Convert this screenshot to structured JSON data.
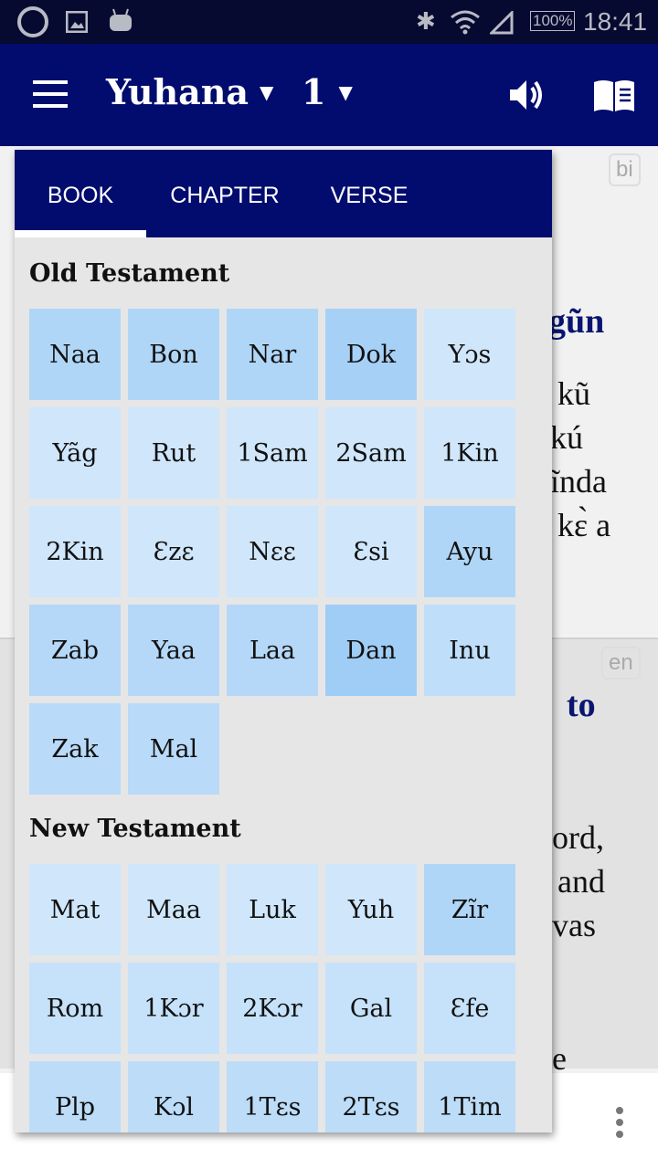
{
  "status_bar": {
    "time": "18:41",
    "battery": "100%",
    "icons": [
      "app-logo-icon",
      "image-icon",
      "android-icon",
      "bluetooth-icon",
      "wifi-icon",
      "signal-icon",
      "battery-icon"
    ]
  },
  "app_bar": {
    "book": "Yuhana",
    "chapter": "1",
    "icons": [
      "menu-icon",
      "speaker-icon",
      "book-icon"
    ]
  },
  "background": {
    "badge_top": "bi",
    "heading_top": "gũn",
    "lines_top": [
      "kũ",
      "kú",
      "ĩnda",
      "kɛ̀ a"
    ],
    "badge_bottom": "en",
    "heading_bottom": "to",
    "lines_bottom": [
      "ord,",
      "and",
      "vas",
      "e"
    ],
    "more_icon": "more-vert-icon"
  },
  "popup": {
    "tabs": [
      {
        "label": "BOOK",
        "active": true
      },
      {
        "label": "CHAPTER"
      },
      {
        "label": "VERSE"
      }
    ],
    "old_testament": {
      "title": "Old Testament",
      "books": [
        {
          "label": "Naa",
          "color": "#b0d6f7"
        },
        {
          "label": "Bon",
          "color": "#b0d6f7"
        },
        {
          "label": "Nar",
          "color": "#b0d6f7"
        },
        {
          "label": "Dok",
          "color": "#a7d0f6"
        },
        {
          "label": "Yɔs",
          "color": "#cfe6fb"
        },
        {
          "label": "Yãg",
          "color": "#cfe6fb"
        },
        {
          "label": "Rut",
          "color": "#cfe6fb"
        },
        {
          "label": "1Sam",
          "color": "#cfe6fb"
        },
        {
          "label": "2Sam",
          "color": "#cfe6fb"
        },
        {
          "label": "1Kin",
          "color": "#cfe6fb"
        },
        {
          "label": "2Kin",
          "color": "#cfe6fb"
        },
        {
          "label": "Ɛzɛ",
          "color": "#cfe6fb"
        },
        {
          "label": "Nɛɛ",
          "color": "#cfe6fb"
        },
        {
          "label": "Ɛsi",
          "color": "#cfe6fb"
        },
        {
          "label": "Ayu",
          "color": "#b0d6f7"
        },
        {
          "label": "Zab",
          "color": "#b5d8f8"
        },
        {
          "label": "Yaa",
          "color": "#b5d8f8"
        },
        {
          "label": "Laa",
          "color": "#b5d8f8"
        },
        {
          "label": "Dan",
          "color": "#9fcdf5"
        },
        {
          "label": "Inu",
          "color": "#bfdefa"
        },
        {
          "label": "Zak",
          "color": "#b9daf8"
        },
        {
          "label": "Mal",
          "color": "#b9daf8"
        }
      ]
    },
    "new_testament": {
      "title": "New Testament",
      "books": [
        {
          "label": "Mat",
          "color": "#cfe6fb"
        },
        {
          "label": "Maa",
          "color": "#cfe6fb"
        },
        {
          "label": "Luk",
          "color": "#cfe6fb"
        },
        {
          "label": "Yuh",
          "color": "#cfe6fb"
        },
        {
          "label": "Zĩr",
          "color": "#b0d6f7"
        },
        {
          "label": "Rom",
          "color": "#c6e2fa"
        },
        {
          "label": "1Kɔr",
          "color": "#c6e2fa"
        },
        {
          "label": "2Kɔr",
          "color": "#c6e2fa"
        },
        {
          "label": "Gal",
          "color": "#c6e2fa"
        },
        {
          "label": "Ɛfe",
          "color": "#c6e2fa"
        },
        {
          "label": "Plp",
          "color": "#bcdcf8"
        },
        {
          "label": "Kɔl",
          "color": "#bcdcf8"
        },
        {
          "label": "1Tɛs",
          "color": "#bcdcf8"
        },
        {
          "label": "2Tɛs",
          "color": "#bcdcf8"
        },
        {
          "label": "1Tim",
          "color": "#bcdcf8"
        }
      ]
    }
  }
}
